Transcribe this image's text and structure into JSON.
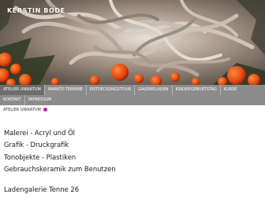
{
  "header": {
    "site_name": "KERSTIN BODE"
  },
  "nav": {
    "row1": [
      {
        "label": "Atelier Unikatum"
      },
      {
        "label": "Markte-Termine"
      },
      {
        "label": "Entdeckungstour"
      },
      {
        "label": "Galerieladen"
      },
      {
        "label": "Kindergeburtstag"
      },
      {
        "label": "Kurse"
      }
    ],
    "row2": [
      {
        "label": "Kontakt"
      },
      {
        "label": "Impressum"
      }
    ],
    "active_index": 0,
    "colors": {
      "bar": "#8c8c8c",
      "active": "#6d6d6d",
      "text": "#ffffff"
    }
  },
  "breadcrumb": {
    "label": "Atelier Unikatum",
    "dot_color": "#c21bb4"
  },
  "main": {
    "lines": [
      "Malerei - Acryl und Öl",
      "Grafik - Druckgrafik",
      "Tonobjekte - Plastiken",
      "Gebrauchskeramik zum Benutzen"
    ],
    "gallery_heading": "Ladengalerie Tenne 26"
  }
}
